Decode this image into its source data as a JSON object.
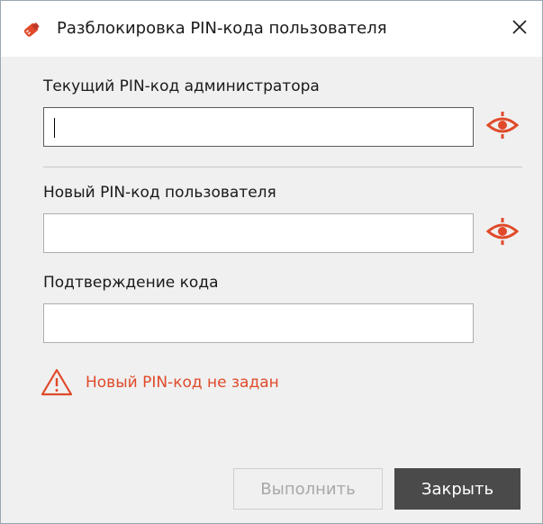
{
  "window": {
    "title": "Разблокировка PIN-кода пользователя",
    "app_icon": "usb-key-icon",
    "close_icon": "close-icon"
  },
  "fields": {
    "admin_pin": {
      "label": "Текущий PIN-код администратора",
      "value": "",
      "focused": true,
      "toggle_icon": "eye-icon"
    },
    "new_pin": {
      "label": "Новый PIN-код пользователя",
      "value": "",
      "toggle_icon": "eye-icon"
    },
    "confirm_pin": {
      "label": "Подтверждение кода",
      "value": ""
    }
  },
  "warning": {
    "icon": "warning-triangle-icon",
    "text": "Новый PIN-код не задан"
  },
  "buttons": {
    "execute_label": "Выполнить",
    "execute_enabled": false,
    "close_label": "Закрыть"
  },
  "colors": {
    "accent": "#e04a2a",
    "primary_button": "#4a4a4a",
    "dialog_background": "#f0f0f0"
  }
}
